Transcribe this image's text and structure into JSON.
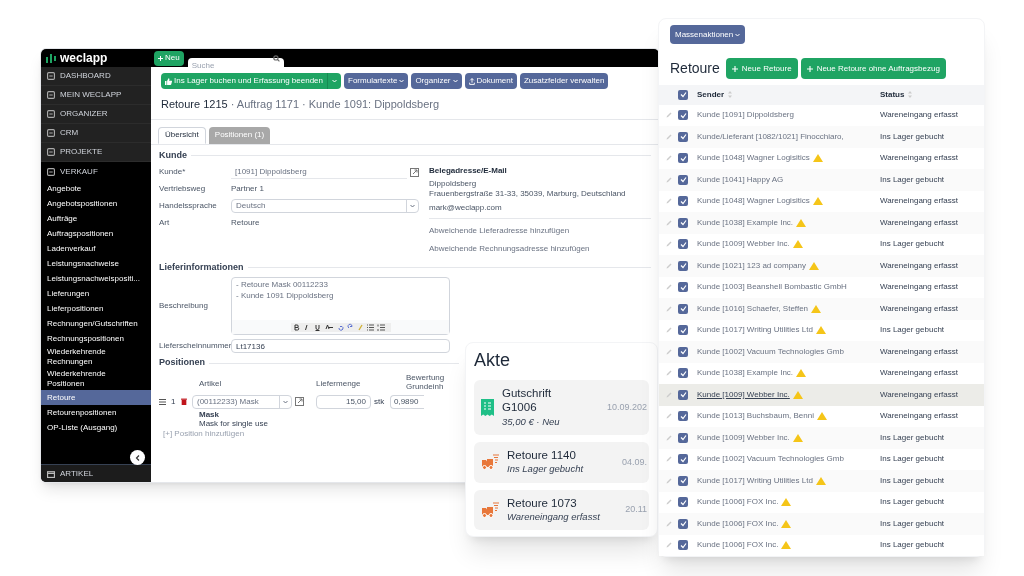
{
  "app": {
    "logo": "weclapp",
    "new_button": "Neu",
    "search": {
      "placeholder": "Suche"
    },
    "sidebar": {
      "items": [
        {
          "label": "DASHBOARD",
          "kind": "section",
          "selected": false
        },
        {
          "label": "MEIN WECLAPP",
          "kind": "section",
          "selected": false
        },
        {
          "label": "ORGANIZER",
          "kind": "section",
          "selected": false
        },
        {
          "label": "CRM",
          "kind": "section",
          "selected": false
        },
        {
          "label": "PROJEKTE",
          "kind": "section",
          "selected": false
        },
        {
          "label": "VERKAUF",
          "kind": "group",
          "selected": false
        },
        {
          "label": "Angebote",
          "kind": "link",
          "selected": false
        },
        {
          "label": "Angebotspositionen",
          "kind": "link",
          "selected": false
        },
        {
          "label": "Aufträge",
          "kind": "link",
          "selected": false
        },
        {
          "label": "Auftragspositionen",
          "kind": "link",
          "selected": false
        },
        {
          "label": "Ladenverkauf",
          "kind": "link",
          "selected": false
        },
        {
          "label": "Leistungsnachweise",
          "kind": "link",
          "selected": false
        },
        {
          "label": "Leistungsnachweispositi...",
          "kind": "link",
          "selected": false
        },
        {
          "label": "Lieferungen",
          "kind": "link",
          "selected": false
        },
        {
          "label": "Lieferpositionen",
          "kind": "link",
          "selected": false
        },
        {
          "label": "Rechnungen/Gutschriften",
          "kind": "link",
          "selected": false
        },
        {
          "label": "Rechnungspositionen",
          "kind": "link",
          "selected": false
        },
        {
          "label": "Wiederkehrende Rechnungen",
          "kind": "link",
          "selected": false
        },
        {
          "label": "Wiederkehrende Positionen",
          "kind": "link",
          "selected": false
        },
        {
          "label": "Retoure",
          "kind": "link",
          "selected": true
        },
        {
          "label": "Retourenpositionen",
          "kind": "link",
          "selected": false
        },
        {
          "label": "OP-Liste (Ausgang)",
          "kind": "link",
          "selected": false
        }
      ],
      "footer": "ARTIKEL"
    },
    "toolbar": [
      {
        "label": "Ins Lager buchen und Erfassung beenden",
        "kind": "split"
      },
      {
        "label": "Formulartexte",
        "kind": "menu"
      },
      {
        "label": "Organizer",
        "kind": "menu"
      },
      {
        "label": "Dokument",
        "kind": "upload"
      },
      {
        "label": "Zusatzfelder verwalten",
        "kind": "plain"
      }
    ],
    "title": {
      "main": "Retoure 1215",
      "rest": "· Auftrag 1171 · Kunde 1091: Dippoldsberg"
    },
    "tabs": [
      {
        "label": "Übersicht",
        "selected": true
      },
      {
        "label": "Positionen (1)",
        "selected": false
      }
    ],
    "customer": {
      "title": "Kunde",
      "fields": [
        {
          "label": "Kunde*",
          "value": "[1091] Dippoldsberg",
          "kind": "link-field"
        },
        {
          "label": "Vertriebsweg",
          "value": "Partner 1",
          "kind": "text"
        },
        {
          "label": "Handelssprache",
          "value": "Deutsch",
          "kind": "select"
        },
        {
          "label": "Art",
          "value": "Retoure",
          "kind": "text"
        }
      ],
      "address": {
        "title": "Belegadresse/E-Mail",
        "lines": [
          "Dippoldsberg",
          "Frauenbergstraße 31-33, 35039, Marburg, Deutschland"
        ],
        "email": "mark@weclapp.com",
        "links": [
          "Abweichende Lieferadresse hinzufügen",
          "Abweichende Rechnungsadresse hinzufügen"
        ]
      }
    },
    "delivery": {
      "title": "Lieferinformationen",
      "description_label": "Beschreibung",
      "description_lines": [
        "- Retoure Mask 00112233",
        "- Kunde 1091 Dippoldsberg"
      ],
      "note_label": "Lieferscheinnummer",
      "note_value": "Lt17136"
    },
    "positions": {
      "title": "Positionen",
      "columns": [
        "Artikel",
        "Liefermenge",
        "Bewertung Grundeinh"
      ],
      "row": {
        "number": "1",
        "article": "(00112233) Mask",
        "name": "Mask",
        "description": "Mask for single use",
        "quantity": "15,00",
        "unit": "stk",
        "value": "0,9890"
      },
      "add": "[+] Position hinzufügen"
    }
  },
  "file_panel": {
    "title": "Akte",
    "entries": [
      {
        "kind": "credit",
        "title": "Gutschrift G1006",
        "subtitle": "35,00 € · Neu",
        "date": "10.09.202"
      },
      {
        "kind": "return",
        "title": "Retoure 1140",
        "subtitle": "Ins Lager gebucht",
        "date": "04.09."
      },
      {
        "kind": "return",
        "title": "Retoure 1073",
        "subtitle": "Wareneingang erfasst",
        "date": "20.11"
      }
    ]
  },
  "list_panel": {
    "bulk_button": "Massenaktionen",
    "title": "Retoure",
    "buttons": [
      "Neue Retoure",
      "Neue Retoure ohne Auftragsbezug"
    ],
    "header_checked": true,
    "columns": [
      "Sender",
      "Status"
    ],
    "rows": [
      {
        "sender": "Kunde [1091] Dippoldsberg",
        "status": "Wareneingang erfasst",
        "warning": false,
        "checked": true,
        "hovered": false
      },
      {
        "sender": "Kunde/Lieferant [1082/1021] Finocchiaro,",
        "status": "Ins Lager gebucht",
        "warning": false,
        "checked": true,
        "hovered": false
      },
      {
        "sender": "Kunde [1048] Wagner Logisitics",
        "status": "Wareneingang erfasst",
        "warning": true,
        "checked": true,
        "hovered": false
      },
      {
        "sender": "Kunde [1041] Happy AG",
        "status": "Ins Lager gebucht",
        "warning": false,
        "checked": true,
        "hovered": false
      },
      {
        "sender": "Kunde [1048] Wagner Logisitics",
        "status": "Wareneingang erfasst",
        "warning": true,
        "checked": true,
        "hovered": false
      },
      {
        "sender": "Kunde [1038] Example Inc.",
        "status": "Wareneingang erfasst",
        "warning": true,
        "checked": true,
        "hovered": false
      },
      {
        "sender": "Kunde [1009] Webber Inc.",
        "status": "Ins Lager gebucht",
        "warning": true,
        "checked": true,
        "hovered": false
      },
      {
        "sender": "Kunde [1021] 123 ad company",
        "status": "Wareneingang erfasst",
        "warning": true,
        "checked": true,
        "hovered": false
      },
      {
        "sender": "Kunde [1003] Beanshell Bombastic GmbH",
        "status": "Wareneingang erfasst",
        "warning": false,
        "checked": true,
        "hovered": false
      },
      {
        "sender": "Kunde [1016] Schaefer, Steffen",
        "status": "Wareneingang erfasst",
        "warning": true,
        "checked": true,
        "hovered": false
      },
      {
        "sender": "Kunde [1017] Writing Utilities Ltd",
        "status": "Ins Lager gebucht",
        "warning": true,
        "checked": true,
        "hovered": false
      },
      {
        "sender": "Kunde [1002] Vacuum Technologies Gmb",
        "status": "Wareneingang erfasst",
        "warning": false,
        "checked": true,
        "hovered": false
      },
      {
        "sender": "Kunde [1038] Example Inc.",
        "status": "Wareneingang erfasst",
        "warning": true,
        "checked": true,
        "hovered": false
      },
      {
        "sender": "Kunde [1009] Webber Inc.",
        "status": "Wareneingang erfasst",
        "warning": true,
        "checked": true,
        "hovered": true
      },
      {
        "sender": "Kunde [1013] Buchsbaum, Benni",
        "status": "Wareneingang erfasst",
        "warning": true,
        "checked": true,
        "hovered": false
      },
      {
        "sender": "Kunde [1009] Webber Inc.",
        "status": "Ins Lager gebucht",
        "warning": true,
        "checked": true,
        "hovered": false
      },
      {
        "sender": "Kunde [1002] Vacuum Technologies Gmb",
        "status": "Ins Lager gebucht",
        "warning": false,
        "checked": true,
        "hovered": false
      },
      {
        "sender": "Kunde [1017] Writing Utilities Ltd",
        "status": "Ins Lager gebucht",
        "warning": true,
        "checked": true,
        "hovered": false
      },
      {
        "sender": "Kunde [1006] FOX Inc.",
        "status": "Ins Lager gebucht",
        "warning": true,
        "checked": true,
        "hovered": false
      },
      {
        "sender": "Kunde [1006] FOX Inc.",
        "status": "Ins Lager gebucht",
        "warning": true,
        "checked": true,
        "hovered": false
      },
      {
        "sender": "Kunde [1006] FOX Inc.",
        "status": "Ins Lager gebucht",
        "warning": true,
        "checked": true,
        "hovered": false
      }
    ]
  }
}
